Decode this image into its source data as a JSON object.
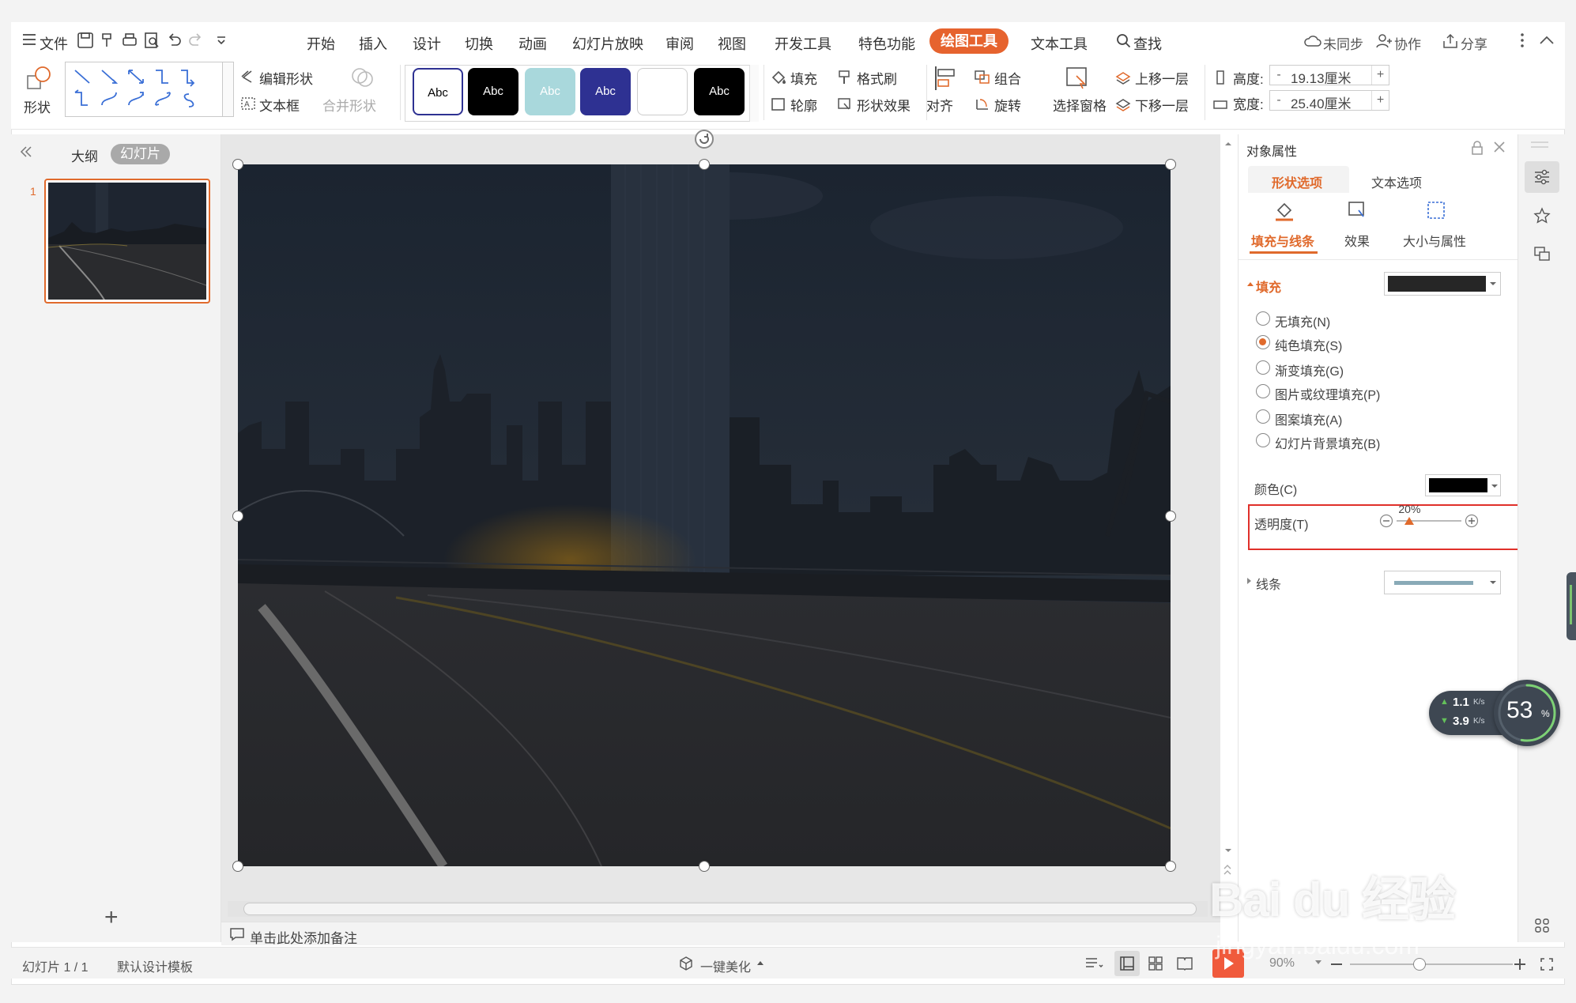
{
  "menu": {
    "file": "文件",
    "tabs": [
      "开始",
      "插入",
      "设计",
      "切换",
      "动画",
      "幻灯片放映",
      "审阅",
      "视图",
      "开发工具",
      "特色功能"
    ],
    "active_tab": "绘图工具",
    "text_tool": "文本工具",
    "search": "查找",
    "sync": "未同步",
    "collab": "协作",
    "share": "分享"
  },
  "ribbon": {
    "shape": "形状",
    "edit_shape": "编辑形状",
    "text_box": "文本框",
    "merge_shape": "合并形状",
    "styles": [
      "Abc",
      "Abc",
      "Abc",
      "Abc",
      "",
      "Abc"
    ],
    "style_colors": [
      "#ffffff",
      "#000000",
      "#a9d8dc",
      "#2e3192",
      "#ffffff",
      "#000000"
    ],
    "fill": "填充",
    "format_painter": "格式刷",
    "outline": "轮廓",
    "shape_effect": "形状效果",
    "align": "对齐",
    "group": "组合",
    "rotate": "旋转",
    "select_pane": "选择窗格",
    "bring_forward": "上移一层",
    "send_backward": "下移一层",
    "height_label": "高度:",
    "height_value": "19.13厘米",
    "width_label": "宽度:",
    "width_value": "25.40厘米"
  },
  "left_panel": {
    "outline_tab": "大纲",
    "slides_tab": "幻灯片",
    "slide_number": "1",
    "add_button": "+"
  },
  "notes": {
    "placeholder": "单击此处添加备注"
  },
  "right_panel": {
    "title": "对象属性",
    "tab_shape": "形状选项",
    "tab_text": "文本选项",
    "sub_fill_line": "填充与线条",
    "sub_effect": "效果",
    "sub_size": "大小与属性",
    "fill_section": "填充",
    "fill_swatch_color": "#262626",
    "fill_options": [
      {
        "label": "无填充(N)",
        "selected": false
      },
      {
        "label": "纯色填充(S)",
        "selected": true
      },
      {
        "label": "渐变填充(G)",
        "selected": false
      },
      {
        "label": "图片或纹理填充(P)",
        "selected": false
      },
      {
        "label": "图案填充(A)",
        "selected": false
      },
      {
        "label": "幻灯片背景填充(B)",
        "selected": false
      }
    ],
    "color_label": "颜色(C)",
    "color_value": "#000000",
    "transparency_label": "透明度(T)",
    "transparency_value": "20%",
    "transparency_level": 0.2,
    "line_section": "线条",
    "accent": "#e06a2c",
    "highlight_border": "#e0302a"
  },
  "speed_widget": {
    "up": "1.1",
    "up_unit": "K/s",
    "down": "3.9",
    "down_unit": "K/s",
    "percent": "53",
    "percent_unit": "%"
  },
  "status": {
    "slide_info": "幻灯片 1 / 1",
    "template": "默认设计模板",
    "beautify": "一键美化",
    "zoom": "90%"
  },
  "watermark": {
    "brand": "Bai du 经验",
    "url": "jingyan.baidu.com"
  }
}
